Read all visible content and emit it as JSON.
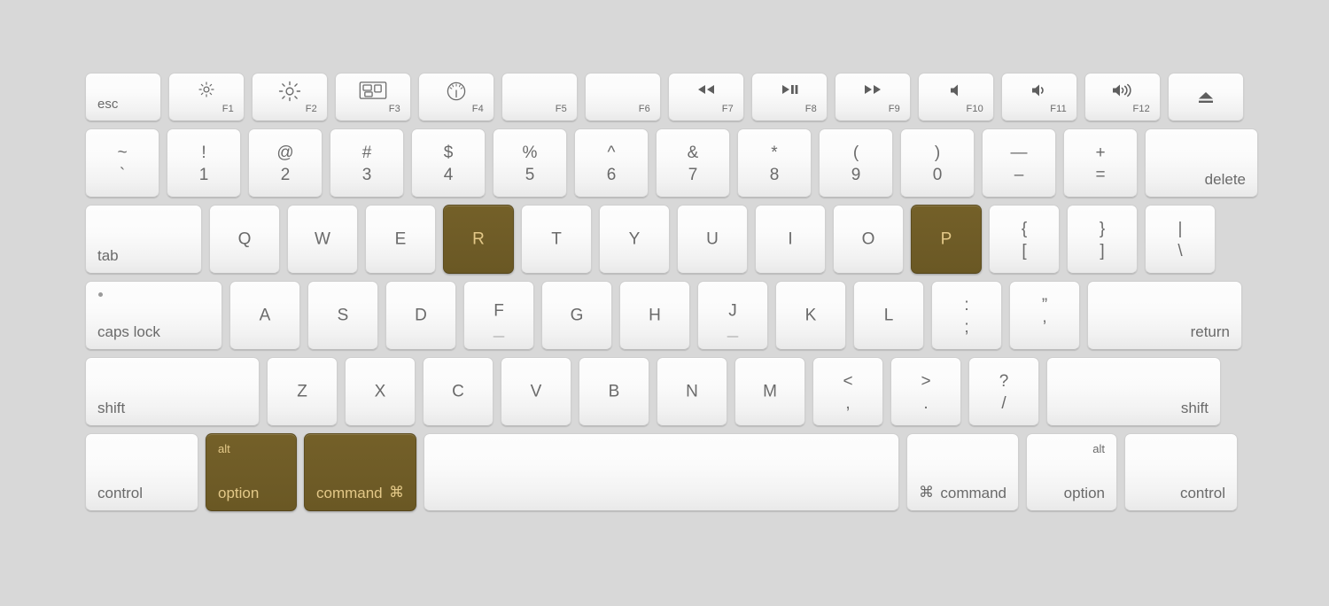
{
  "meta": {
    "device": "Apple Keyboard",
    "background_color": "#d8d8d8",
    "key_color": "#fbfbfb",
    "key_text_color": "#6a6a6a",
    "highlight_color": "#6f5c27",
    "highlight_text_color": "#e3c888",
    "highlighted_keys": [
      "R",
      "P",
      "option",
      "command"
    ]
  },
  "rows": {
    "function": [
      {
        "name": "esc",
        "label": "esc"
      },
      {
        "name": "f1",
        "icon": "brightness-down-icon",
        "fn": "F1"
      },
      {
        "name": "f2",
        "icon": "brightness-up-icon",
        "fn": "F2"
      },
      {
        "name": "f3",
        "icon": "mission-control-icon",
        "fn": "F3"
      },
      {
        "name": "f4",
        "icon": "dashboard-icon",
        "fn": "F4"
      },
      {
        "name": "f5",
        "icon": "",
        "fn": "F5"
      },
      {
        "name": "f6",
        "icon": "",
        "fn": "F6"
      },
      {
        "name": "f7",
        "icon": "rewind-icon",
        "fn": "F7"
      },
      {
        "name": "f8",
        "icon": "play-pause-icon",
        "fn": "F8"
      },
      {
        "name": "f9",
        "icon": "fast-forward-icon",
        "fn": "F9"
      },
      {
        "name": "f10",
        "icon": "mute-icon",
        "fn": "F10"
      },
      {
        "name": "f11",
        "icon": "volume-down-icon",
        "fn": "F11"
      },
      {
        "name": "f12",
        "icon": "volume-up-icon",
        "fn": "F12"
      },
      {
        "name": "eject",
        "icon": "eject-icon",
        "fn": ""
      }
    ],
    "number": [
      {
        "name": "tilde",
        "top": "~",
        "bottom": "`"
      },
      {
        "name": "one",
        "top": "!",
        "bottom": "1"
      },
      {
        "name": "two",
        "top": "@",
        "bottom": "2"
      },
      {
        "name": "three",
        "top": "#",
        "bottom": "3"
      },
      {
        "name": "four",
        "top": "$",
        "bottom": "4"
      },
      {
        "name": "five",
        "top": "%",
        "bottom": "5"
      },
      {
        "name": "six",
        "top": "^",
        "bottom": "6"
      },
      {
        "name": "seven",
        "top": "&",
        "bottom": "7"
      },
      {
        "name": "eight",
        "top": "*",
        "bottom": "8"
      },
      {
        "name": "nine",
        "top": "(",
        "bottom": "9"
      },
      {
        "name": "zero",
        "top": ")",
        "bottom": "0"
      },
      {
        "name": "minus",
        "top": "—",
        "bottom": "–"
      },
      {
        "name": "equal",
        "top": "+",
        "bottom": "="
      },
      {
        "name": "delete",
        "label": "delete"
      }
    ],
    "top_letters": [
      {
        "name": "tab",
        "label": "tab"
      },
      {
        "name": "q",
        "label": "Q"
      },
      {
        "name": "w",
        "label": "W"
      },
      {
        "name": "e",
        "label": "E"
      },
      {
        "name": "r",
        "label": "R",
        "highlight": true
      },
      {
        "name": "t",
        "label": "T"
      },
      {
        "name": "y",
        "label": "Y"
      },
      {
        "name": "u",
        "label": "U"
      },
      {
        "name": "i",
        "label": "I"
      },
      {
        "name": "o",
        "label": "O"
      },
      {
        "name": "p",
        "label": "P",
        "highlight": true
      },
      {
        "name": "bracket-left",
        "top": "{",
        "bottom": "["
      },
      {
        "name": "bracket-right",
        "top": "}",
        "bottom": "]"
      },
      {
        "name": "backslash",
        "top": "|",
        "bottom": "\\"
      }
    ],
    "home_letters": [
      {
        "name": "caps-lock",
        "label": "caps lock"
      },
      {
        "name": "a",
        "label": "A"
      },
      {
        "name": "s",
        "label": "S"
      },
      {
        "name": "d",
        "label": "D"
      },
      {
        "name": "f",
        "label": "F",
        "homing": true
      },
      {
        "name": "g",
        "label": "G"
      },
      {
        "name": "h",
        "label": "H"
      },
      {
        "name": "j",
        "label": "J",
        "homing": true
      },
      {
        "name": "k",
        "label": "K"
      },
      {
        "name": "l",
        "label": "L"
      },
      {
        "name": "semicolon",
        "top": ":",
        "bottom": ";"
      },
      {
        "name": "quote",
        "top": "”",
        "bottom": "’"
      },
      {
        "name": "return",
        "label": "return"
      }
    ],
    "bottom_letters": [
      {
        "name": "shift-left",
        "label": "shift"
      },
      {
        "name": "z",
        "label": "Z"
      },
      {
        "name": "x",
        "label": "X"
      },
      {
        "name": "c",
        "label": "C"
      },
      {
        "name": "v",
        "label": "V"
      },
      {
        "name": "b",
        "label": "B"
      },
      {
        "name": "n",
        "label": "N"
      },
      {
        "name": "m",
        "label": "M"
      },
      {
        "name": "comma",
        "top": "<",
        "bottom": ","
      },
      {
        "name": "period",
        "top": ">",
        "bottom": "."
      },
      {
        "name": "slash",
        "top": "?",
        "bottom": "/"
      },
      {
        "name": "shift-right",
        "label": "shift"
      }
    ],
    "modifier": [
      {
        "name": "control-left",
        "label": "control"
      },
      {
        "name": "option-left",
        "label": "option",
        "alt": "alt",
        "highlight": true
      },
      {
        "name": "command-left",
        "label": "command",
        "symbol": "⌘",
        "highlight": true
      },
      {
        "name": "space",
        "label": ""
      },
      {
        "name": "command-right",
        "label": "command",
        "symbol": "⌘"
      },
      {
        "name": "option-right",
        "label": "option",
        "alt": "alt"
      },
      {
        "name": "control-right",
        "label": "control"
      }
    ]
  }
}
